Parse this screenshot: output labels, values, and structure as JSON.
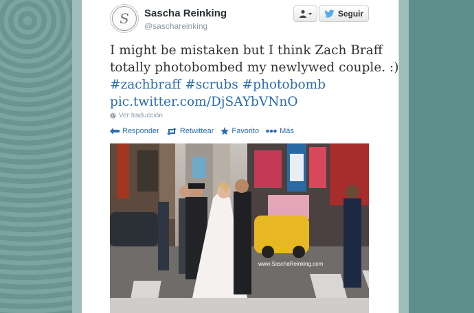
{
  "user": {
    "name": "Sascha Reinking",
    "handle": "@saschareinking",
    "avatar_initial": "S"
  },
  "buttons": {
    "user_menu_icon": "person-dropdown-icon",
    "follow_label": "Seguir"
  },
  "tweet": {
    "line1": "I might be mistaken but I think Zach Braff",
    "line2": "totally photobombed my newlywed couple. :)",
    "hashtags": [
      "#zachbraff",
      "#scrubs",
      "#photobomb"
    ],
    "pic_link": "pic.twitter.com/DjSAYbVNnO",
    "translate_label": "Ver traducción"
  },
  "actions": [
    {
      "label": "Responder",
      "icon": "reply-icon"
    },
    {
      "label": "Retwittear",
      "icon": "retweet-icon"
    },
    {
      "label": "Favorito",
      "icon": "star-icon"
    },
    {
      "label": "Más",
      "icon": "more-icon"
    }
  ],
  "photo": {
    "watermark": "www.SaschaReinking.com"
  },
  "colors": {
    "link": "#2a6cb0",
    "background": "#5e8f8d",
    "twitter_blue": "#55acee"
  }
}
